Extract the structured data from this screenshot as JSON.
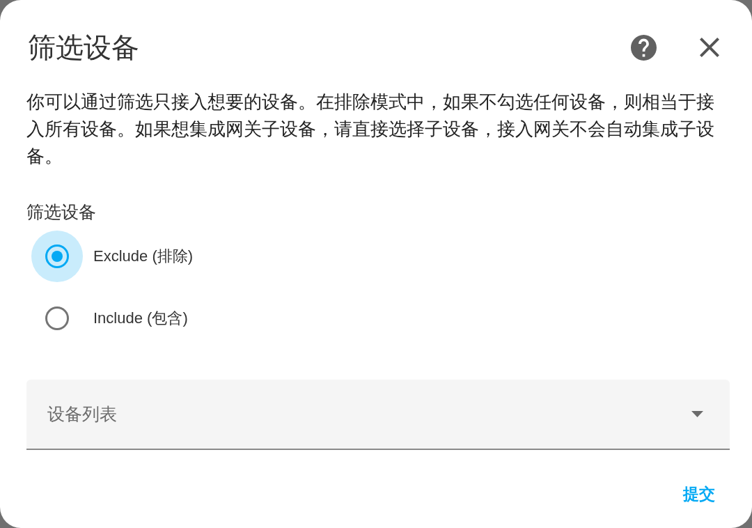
{
  "dialog": {
    "title": "筛选设备",
    "description": "你可以通过筛选只接入想要的设备。在排除模式中，如果不勾选任何设备，则相当于接入所有设备。如果想集成网关子设备，请直接选择子设备，接入网关不会自动集成子设备。"
  },
  "filter_mode": {
    "label": "筛选设备",
    "options": [
      {
        "label": "Exclude (排除)",
        "selected": true
      },
      {
        "label": "Include (包含)",
        "selected": false
      }
    ]
  },
  "device_list": {
    "label": "设备列表"
  },
  "actions": [
    {
      "label": "提交"
    }
  ]
}
